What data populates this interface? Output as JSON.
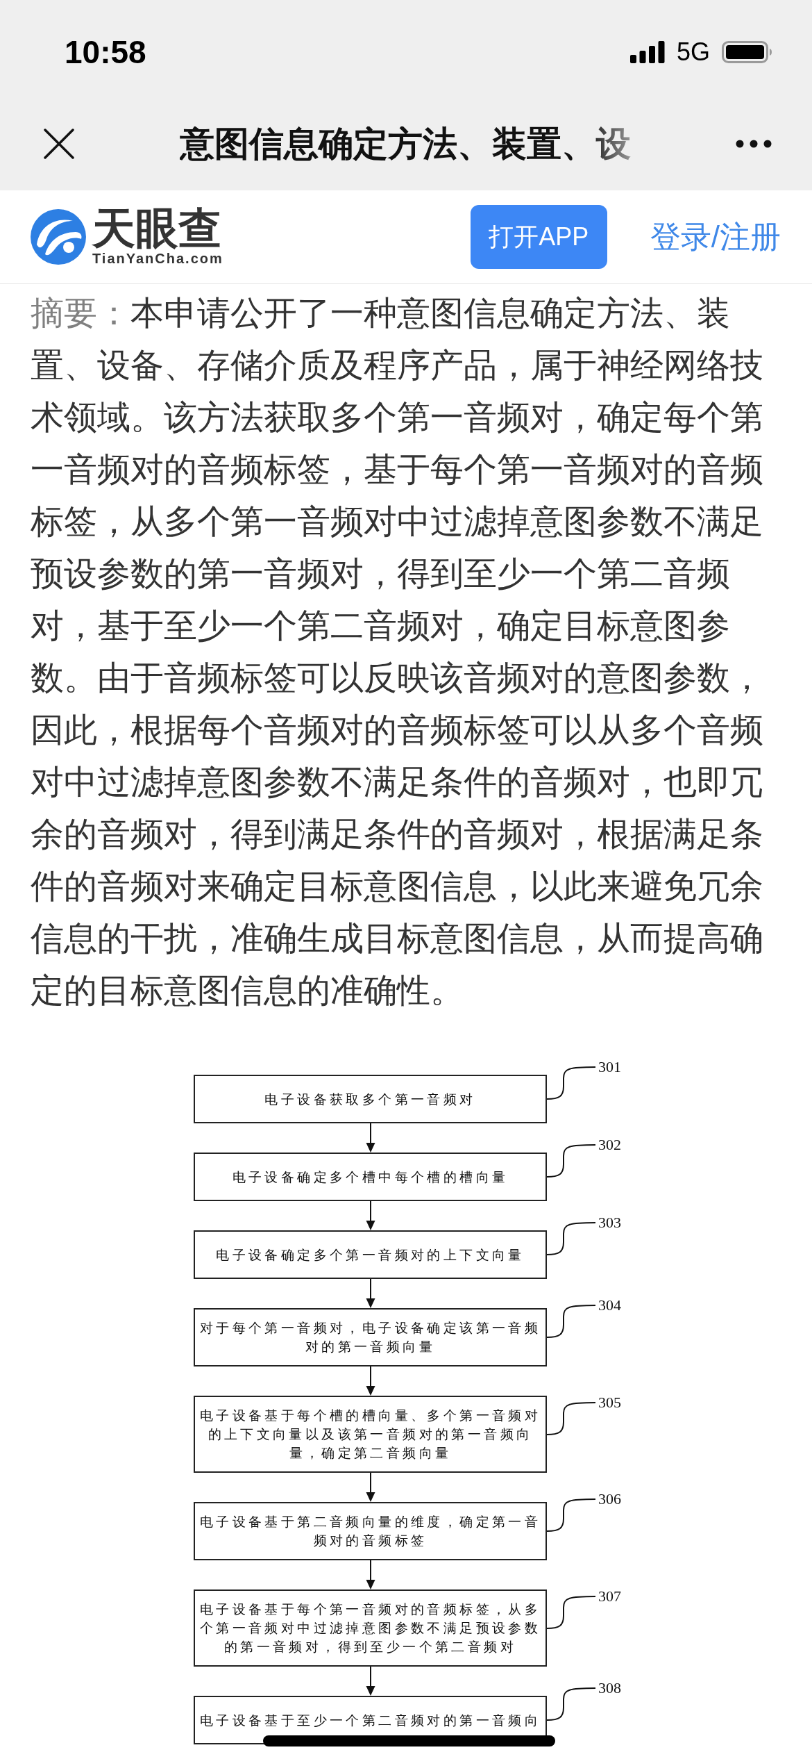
{
  "status_bar": {
    "time": "10:58",
    "network": "5G"
  },
  "nav_bar": {
    "title": "意图信息确定方法、装置、设"
  },
  "site_header": {
    "logo_name": "天眼查",
    "logo_domain": "TianYanCha.com",
    "open_app_button": "打开APP",
    "login_link": "登录/注册"
  },
  "abstract": {
    "label": "摘要：",
    "text": "本申请公开了一种意图信息确定方法、装置、设备、存储介质及程序产品，属于神经网络技术领域。该方法获取多个第一音频对，确定每个第一音频对的音频标签，基于每个第一音频对的音频标签，从多个第一音频对中过滤掉意图参数不满足预设参数的第一音频对，得到至少一个第二音频对，基于至少一个第二音频对，确定目标意图参数。由于音频标签可以反映该音频对的意图参数，因此，根据每个音频对的音频标签可以从多个音频对中过滤掉意图参数不满足条件的音频对，也即冗余的音频对，得到满足条件的音频对，根据满足条件的音频对来确定目标意图信息，以此来避免冗余信息的干扰，准确生成目标意图信息，从而提高确定的目标意图信息的准确性。"
  },
  "flowchart": {
    "steps": [
      {
        "number": "301",
        "text": "电子设备获取多个第一音频对"
      },
      {
        "number": "302",
        "text": "电子设备确定多个槽中每个槽的槽向量"
      },
      {
        "number": "303",
        "text": "电子设备确定多个第一音频对的上下文向量"
      },
      {
        "number": "304",
        "text": "对于每个第一音频对，电子设备确定该第一音频对的第一音频向量"
      },
      {
        "number": "305",
        "text": "电子设备基于每个槽的槽向量、多个第一音频对的上下文向量以及该第一音频对的第一音频向量，确定第二音频向量"
      },
      {
        "number": "306",
        "text": "电子设备基于第二音频向量的维度，确定第一音频对的音频标签"
      },
      {
        "number": "307",
        "text": "电子设备基于每个第一音频对的音频标签，从多个第一音频对中过滤掉意图参数不满足预设参数的第一音频对，得到至少一个第二音频对"
      },
      {
        "number": "308",
        "text": "电子设备基于至少一个第二音频对的第一音频向"
      }
    ]
  }
}
